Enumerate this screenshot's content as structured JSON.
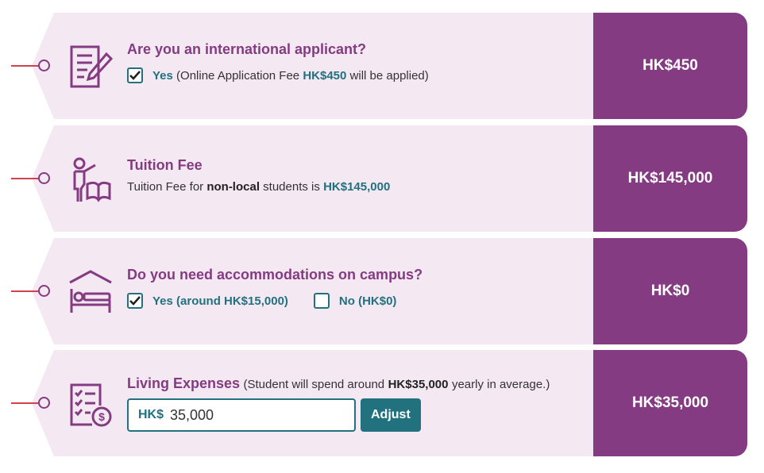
{
  "rows": [
    {
      "title": "Are you an international applicant?",
      "option_yes_label": "Yes",
      "option_yes_checked": true,
      "desc_pre": "(Online Application Fee",
      "desc_amount": "HK$450",
      "desc_post": "will be applied)",
      "price": "HK$450",
      "icon": "document-pen-icon"
    },
    {
      "title": "Tuition Fee",
      "desc_pre": "Tuition Fee for",
      "desc_bold": "non-local",
      "desc_mid": "students is",
      "desc_amount": "HK$145,000",
      "price": "HK$145,000",
      "icon": "teacher-book-icon"
    },
    {
      "title": "Do you need accommodations on campus?",
      "option_yes_label": "Yes (around HK$15,000)",
      "option_yes_checked": true,
      "option_no_label": "No (HK$0)",
      "option_no_checked": false,
      "price": "HK$0",
      "icon": "bed-house-icon"
    },
    {
      "title": "Living Expenses",
      "desc_pre": "(Student will spend around",
      "desc_amount": "HK$35,000",
      "desc_post": "yearly in average.)",
      "input_prefix": "HK$",
      "input_value": "35,000",
      "button_label": "Adjust",
      "price": "HK$35,000",
      "icon": "checklist-dollar-icon"
    }
  ],
  "colors": {
    "accent": "#843b82",
    "teal": "#21717f",
    "tag_bg": "#f4e8f2",
    "pin_line": "#d0434d"
  }
}
